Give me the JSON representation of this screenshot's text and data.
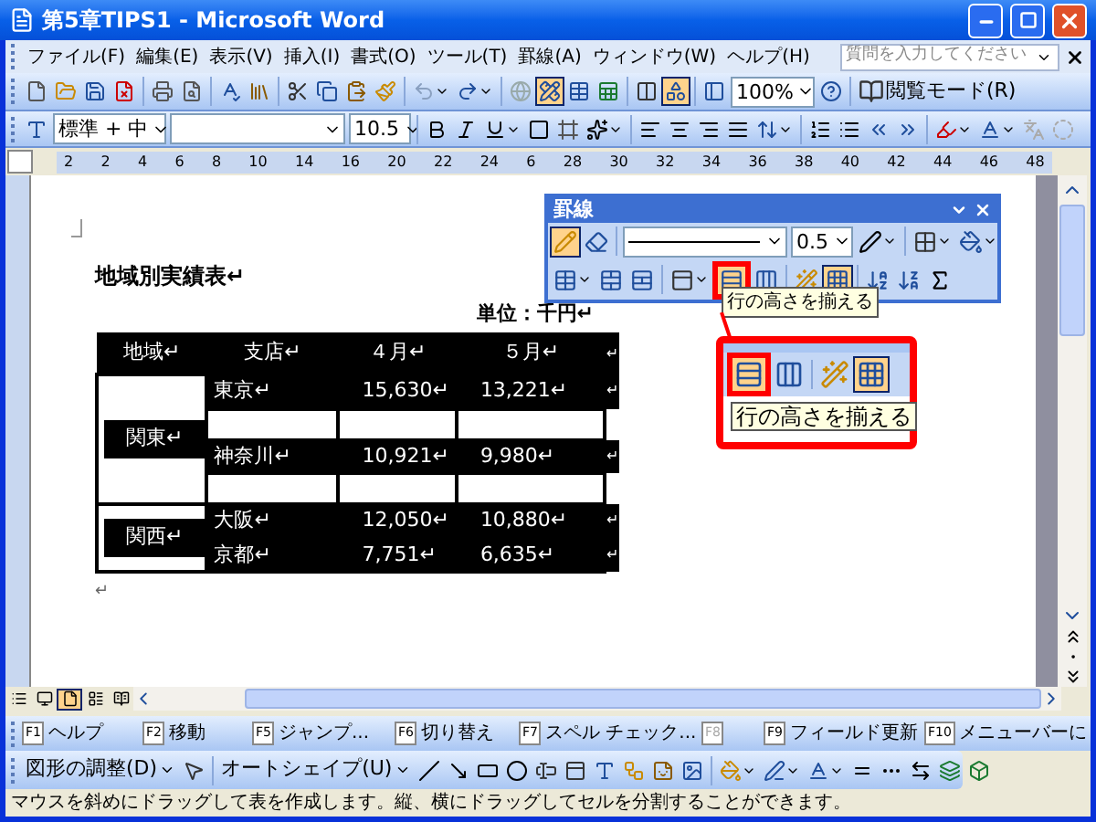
{
  "window": {
    "title": "第5章TIPS1 - Microsoft Word"
  },
  "menu": {
    "items": [
      "ファイル(F)",
      "編集(E)",
      "表示(V)",
      "挿入(I)",
      "書式(O)",
      "ツール(T)",
      "罫線(A)",
      "ウィンドウ(W)",
      "ヘルプ(H)"
    ],
    "search": {
      "placeholder": "質問を入力してください"
    }
  },
  "standard_toolbar": [
    {
      "kind": "new",
      "on": false
    },
    {
      "kind": "open",
      "on": false
    },
    {
      "kind": "save",
      "on": false
    },
    {
      "kind": "permission",
      "on": false
    },
    {
      "kind": "separator"
    },
    {
      "kind": "print",
      "on": false
    },
    {
      "kind": "preview",
      "on": false
    },
    {
      "kind": "separator"
    },
    {
      "kind": "spelling",
      "on": false
    },
    {
      "kind": "research",
      "on": false
    },
    {
      "kind": "separator"
    },
    {
      "kind": "cut",
      "on": false
    },
    {
      "kind": "copy",
      "on": false
    },
    {
      "kind": "paste",
      "on": false
    },
    {
      "kind": "painter",
      "on": false
    },
    {
      "kind": "separator"
    },
    {
      "kind": "undo",
      "on": false,
      "menu": true
    },
    {
      "kind": "redo",
      "on": false,
      "menu": true
    },
    {
      "kind": "separator"
    },
    {
      "kind": "hyperlink",
      "on": false
    },
    {
      "kind": "tables_borders",
      "on": true
    },
    {
      "kind": "insert_table",
      "on": false
    },
    {
      "kind": "insert_sheet",
      "on": false
    },
    {
      "kind": "separator"
    },
    {
      "kind": "columns",
      "on": false
    },
    {
      "kind": "drawing",
      "on": true
    },
    {
      "kind": "separator"
    },
    {
      "kind": "doc_map",
      "on": false
    },
    {
      "kind": "zoom_box",
      "value": "100%",
      "menu": true
    },
    {
      "kind": "help",
      "on": false
    },
    {
      "kind": "separator"
    },
    {
      "kind": "reading_label",
      "label": "閲覧モード(R)"
    }
  ],
  "formatting_toolbar": [
    {
      "kind": "styles",
      "on": false
    },
    {
      "kind": "style_box",
      "value": "標準 + 中",
      "menu": true
    },
    {
      "kind": "font_box",
      "menu": true
    },
    {
      "kind": "size_box",
      "value": "10.5",
      "menu": true
    },
    {
      "kind": "separator"
    },
    {
      "kind": "bold",
      "on": false
    },
    {
      "kind": "italic",
      "on": false
    },
    {
      "kind": "underline",
      "on": false,
      "menu": true
    },
    {
      "kind": "char_border",
      "on": false
    },
    {
      "kind": "char_shading",
      "on": false
    },
    {
      "kind": "emphasis",
      "on": false,
      "menu": true
    },
    {
      "kind": "separator"
    },
    {
      "kind": "align_left",
      "on": false
    },
    {
      "kind": "align_center",
      "on": false
    },
    {
      "kind": "align_right",
      "on": false
    },
    {
      "kind": "justify",
      "on": false
    },
    {
      "kind": "line_spacing",
      "on": false,
      "menu": true
    },
    {
      "kind": "separator"
    },
    {
      "kind": "numbering",
      "on": false
    },
    {
      "kind": "bullets",
      "on": false
    },
    {
      "kind": "outdent",
      "on": false
    },
    {
      "kind": "indent",
      "on": false
    },
    {
      "kind": "separator"
    },
    {
      "kind": "highlight",
      "on": false,
      "menu": true
    },
    {
      "kind": "font_color",
      "on": false,
      "menu": true
    },
    {
      "kind": "phonetic",
      "on": false
    },
    {
      "kind": "enclosed",
      "on": false
    }
  ],
  "ruler": [
    "2",
    "2",
    "4",
    "6",
    "8",
    "10",
    "14",
    "16",
    "20",
    "22",
    "24",
    "6",
    "28",
    "30",
    "32",
    "34",
    "36",
    "38",
    "40",
    "42",
    "44",
    "46",
    "48"
  ],
  "document": {
    "heading": "地域別実績表↵",
    "unit": "単位：千円↵",
    "table": {
      "columns": [
        {
          "text": "地域↵",
          "selected": true
        },
        {
          "text": "支店↵",
          "selected": true
        },
        {
          "text": "４月↵",
          "selected": true
        },
        {
          "text": "５月↵",
          "selected": true
        }
      ],
      "header_end": "↵",
      "groups": [
        {
          "region": "関東↵",
          "selected": true,
          "rows": [
            {
              "branch": "東京↵",
              "april": "15,630↵",
              "may": "13,221↵",
              "end": "↵",
              "selected": true
            },
            {
              "selected": false
            },
            {
              "branch": "神奈川↵",
              "april": "10,921↵",
              "may": "9,980↵",
              "end": "↵",
              "selected": true
            },
            {
              "selected": false
            }
          ]
        },
        {
          "region": "関西↵",
          "selected": true,
          "rows": [
            {
              "branch": "大阪↵",
              "april": "12,050↵",
              "may": "10,880↵",
              "end": "↵",
              "selected": true
            },
            {
              "branch": "京都↵",
              "april": "7,751↵",
              "may": "6,635↵",
              "end": "↵",
              "selected": true
            }
          ]
        }
      ]
    },
    "end_mark": "↵"
  },
  "tables_toolbar": {
    "title": "罫線",
    "row_1": [
      {
        "kind": "draw_table",
        "on": true
      },
      {
        "kind": "eraser",
        "on": false
      },
      {
        "kind": "separator"
      },
      {
        "kind": "line_box",
        "menu": true
      },
      {
        "kind": "weight_box",
        "value": "0.5",
        "menu": true
      },
      {
        "kind": "pen_color",
        "on": false,
        "menu": true
      },
      {
        "kind": "separator"
      },
      {
        "kind": "border",
        "on": false,
        "menu": true
      },
      {
        "kind": "shading",
        "on": false,
        "menu": true
      }
    ],
    "row_2": [
      {
        "kind": "insert_table",
        "on": false,
        "menu": true
      },
      {
        "kind": "merge",
        "on": false
      },
      {
        "kind": "split",
        "on": false
      },
      {
        "kind": "separator"
      },
      {
        "kind": "cell_align",
        "on": false,
        "menu": true
      },
      {
        "kind": "distribute_rows",
        "on": true,
        "marked": true
      },
      {
        "kind": "distribute_cols",
        "on": false
      },
      {
        "kind": "separator"
      },
      {
        "kind": "autoformat",
        "on": false
      },
      {
        "kind": "gridlines",
        "on": true
      },
      {
        "kind": "separator"
      },
      {
        "kind": "sort_asc",
        "on": false
      },
      {
        "kind": "sort_desc",
        "on": false
      },
      {
        "kind": "sum",
        "on": false
      }
    ],
    "tooltip": "行の高さを揃える"
  },
  "callout": {
    "buttons": [
      {
        "kind": "distribute_rows",
        "on": true,
        "marked": true
      },
      {
        "kind": "distribute_cols",
        "on": false
      },
      {
        "kind": "separator"
      },
      {
        "kind": "autoformat",
        "on": false
      },
      {
        "kind": "gridlines",
        "on": true
      }
    ],
    "tooltip": "行の高さを揃える"
  },
  "view_buttons": [
    {
      "kind": "normal",
      "selected": false
    },
    {
      "kind": "web",
      "selected": false
    },
    {
      "kind": "print_layout",
      "selected": true
    },
    {
      "kind": "outline",
      "selected": false
    },
    {
      "kind": "reading",
      "selected": false
    }
  ],
  "function_keys": [
    {
      "key": "F1",
      "label": "ヘルプ",
      "disabled": false
    },
    {
      "key": "F2",
      "label": "移動",
      "disabled": false
    },
    {
      "key": "F5",
      "label": "ジャンプ...",
      "disabled": false
    },
    {
      "key": "F6",
      "label": "切り替え",
      "disabled": false
    },
    {
      "key": "F7",
      "label": "スペル チェック...",
      "disabled": false
    },
    {
      "key": "F8",
      "disabled": true
    },
    {
      "key": "F9",
      "label": "フィールド更新",
      "disabled": false
    },
    {
      "key": "F10",
      "label": "メニューバーに",
      "disabled": false
    }
  ],
  "drawing_toolbar": [
    {
      "kind": "label",
      "label": "図形の調整(D)",
      "menu": true
    },
    {
      "kind": "pointer",
      "on": false
    },
    {
      "kind": "separator"
    },
    {
      "kind": "label",
      "label": "オートシェイプ(U)",
      "menu": true
    },
    {
      "kind": "line",
      "on": false
    },
    {
      "kind": "arrow",
      "on": false
    },
    {
      "kind": "rect",
      "on": false
    },
    {
      "kind": "oval",
      "on": false
    },
    {
      "kind": "textbox",
      "on": false
    },
    {
      "kind": "vtextbox",
      "on": false
    },
    {
      "kind": "wordart",
      "on": false
    },
    {
      "kind": "diagram",
      "on": false
    },
    {
      "kind": "clipart",
      "on": false
    },
    {
      "kind": "picture",
      "on": false
    },
    {
      "kind": "separator"
    },
    {
      "kind": "fill",
      "on": false,
      "menu": true
    },
    {
      "kind": "line_color",
      "on": false,
      "menu": true
    },
    {
      "kind": "font_color",
      "on": false,
      "menu": true
    },
    {
      "kind": "line_style",
      "on": false
    },
    {
      "kind": "dash_style",
      "on": false
    },
    {
      "kind": "arrow_style",
      "on": false
    },
    {
      "kind": "shadow",
      "on": false
    },
    {
      "kind": "threed",
      "on": false
    }
  ],
  "status_bar": "マウスを斜めにドラッグして表を作成します。縦、横にドラッグしてセルを分割することができます。"
}
